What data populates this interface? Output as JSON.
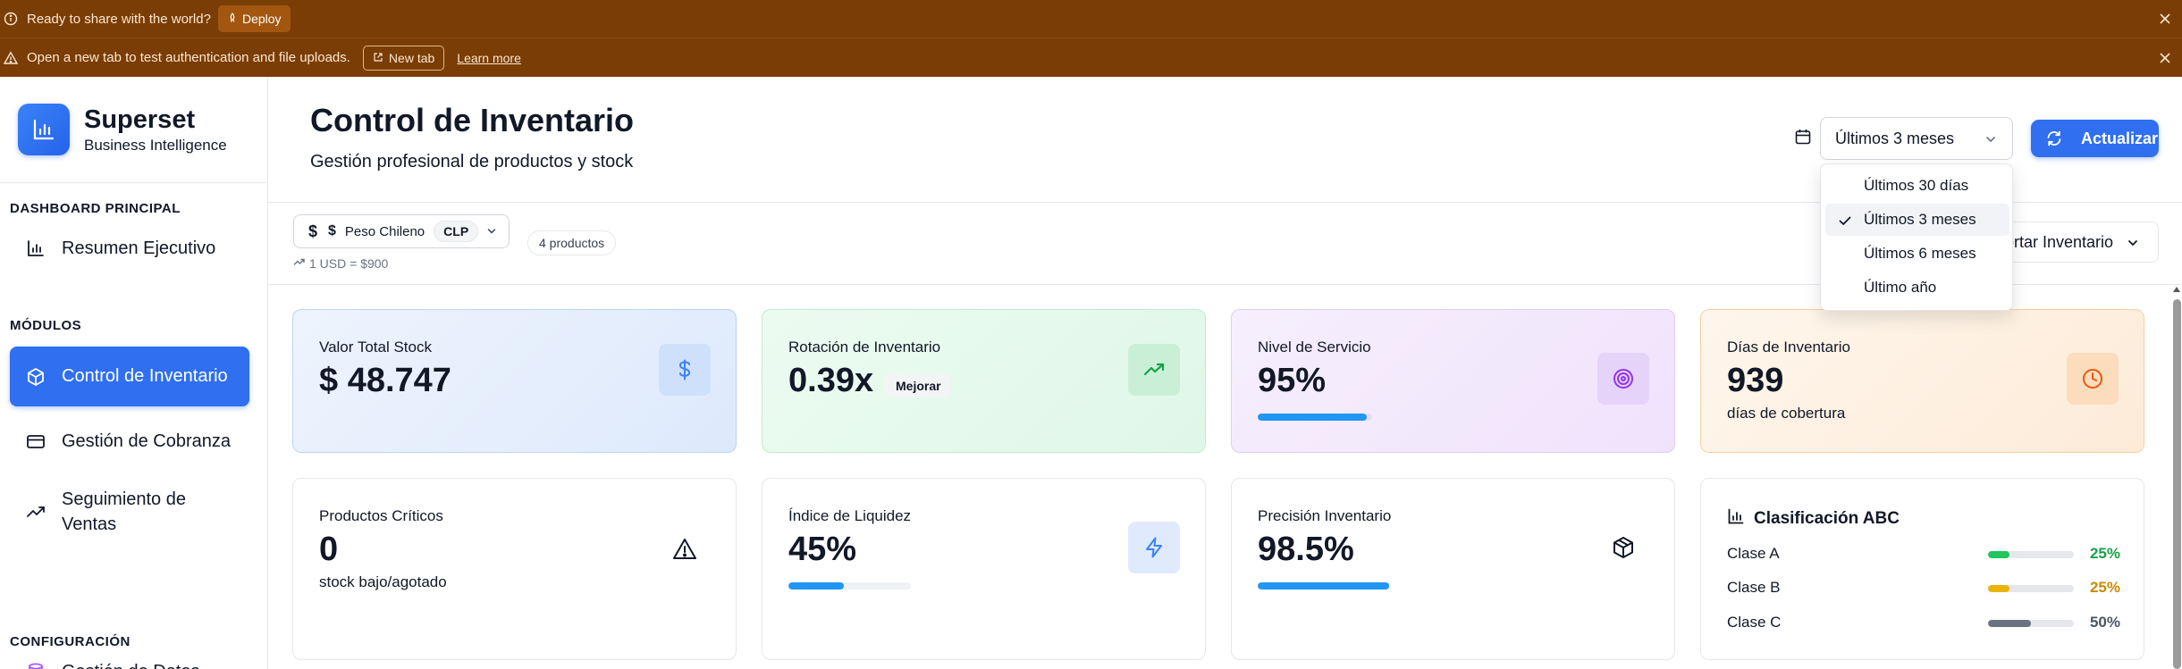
{
  "banners": {
    "deploy": {
      "text": "Ready to share with the world?",
      "button": "Deploy"
    },
    "auth": {
      "text": "Open a new tab to test authentication and file uploads.",
      "button": "New tab",
      "link": "Learn more"
    }
  },
  "sidebar": {
    "brand_name": "Superset",
    "brand_sub": "Business Intelligence",
    "section_main": "DASHBOARD PRINCIPAL",
    "section_modules": "MÓDULOS",
    "section_config": "CONFIGURACIÓN",
    "items": [
      {
        "label": "Resumen Ejecutivo",
        "icon": "bar-chart-icon"
      },
      {
        "label": "Control de Inventario",
        "icon": "package-icon",
        "active": true
      },
      {
        "label": "Gestión de Cobranza",
        "icon": "credit-card-icon"
      },
      {
        "label": "Seguimiento de Ventas",
        "icon": "trending-up-icon"
      },
      {
        "label": "Gestión de Datos",
        "icon": "database-icon"
      }
    ]
  },
  "header": {
    "title": "Control de Inventario",
    "subtitle": "Gestión profesional de productos y stock",
    "period_selected": "Últimos 3 meses",
    "refresh_label": "Actualizar"
  },
  "toolbar": {
    "currency_symbol": "$",
    "currency_name": "Peso Chileno",
    "currency_code": "CLP",
    "rate": "1 USD = $900",
    "product_count": "4 productos",
    "export_label": "Exportar Inventario"
  },
  "period_menu": {
    "options": [
      "Últimos 30 días",
      "Últimos 3 meses",
      "Últimos 6 meses",
      "Último año"
    ],
    "selected_index": 1
  },
  "kpis": {
    "valor_total": {
      "label": "Valor Total Stock",
      "value": "$ 48.747"
    },
    "rotacion": {
      "label": "Rotación de Inventario",
      "value": "0.39x",
      "badge": "Mejorar"
    },
    "nivel_servicio": {
      "label": "Nivel de Servicio",
      "value": "95%",
      "progress": 0.95
    },
    "dias_inventario": {
      "label": "Días de Inventario",
      "value": "939",
      "sub": "días de cobertura"
    },
    "productos_criticos": {
      "label": "Productos Críticos",
      "value": "0",
      "sub": "stock bajo/agotado"
    },
    "liquidez": {
      "label": "Índice de Liquidez",
      "value": "45%",
      "progress": 0.45
    },
    "precision": {
      "label": "Precisión Inventario",
      "value": "98.5%",
      "progress": 0.985
    }
  },
  "abc": {
    "title": "Clasificación ABC",
    "rows": [
      {
        "label": "Clase A",
        "pct": "25%",
        "value": 0.25,
        "color": "#22c55e"
      },
      {
        "label": "Clase B",
        "pct": "25%",
        "value": 0.25,
        "color": "#eab308"
      },
      {
        "label": "Clase C",
        "pct": "50%",
        "value": 0.5,
        "color": "#6b7280"
      }
    ]
  },
  "colors": {
    "banner_bg": "#7a3d06",
    "accent": "#2f6ff0",
    "progress": "#2196f3",
    "abc_a_text": "#16a34a",
    "abc_b_text": "#ca8a04",
    "abc_c_text": "#4b5563"
  }
}
